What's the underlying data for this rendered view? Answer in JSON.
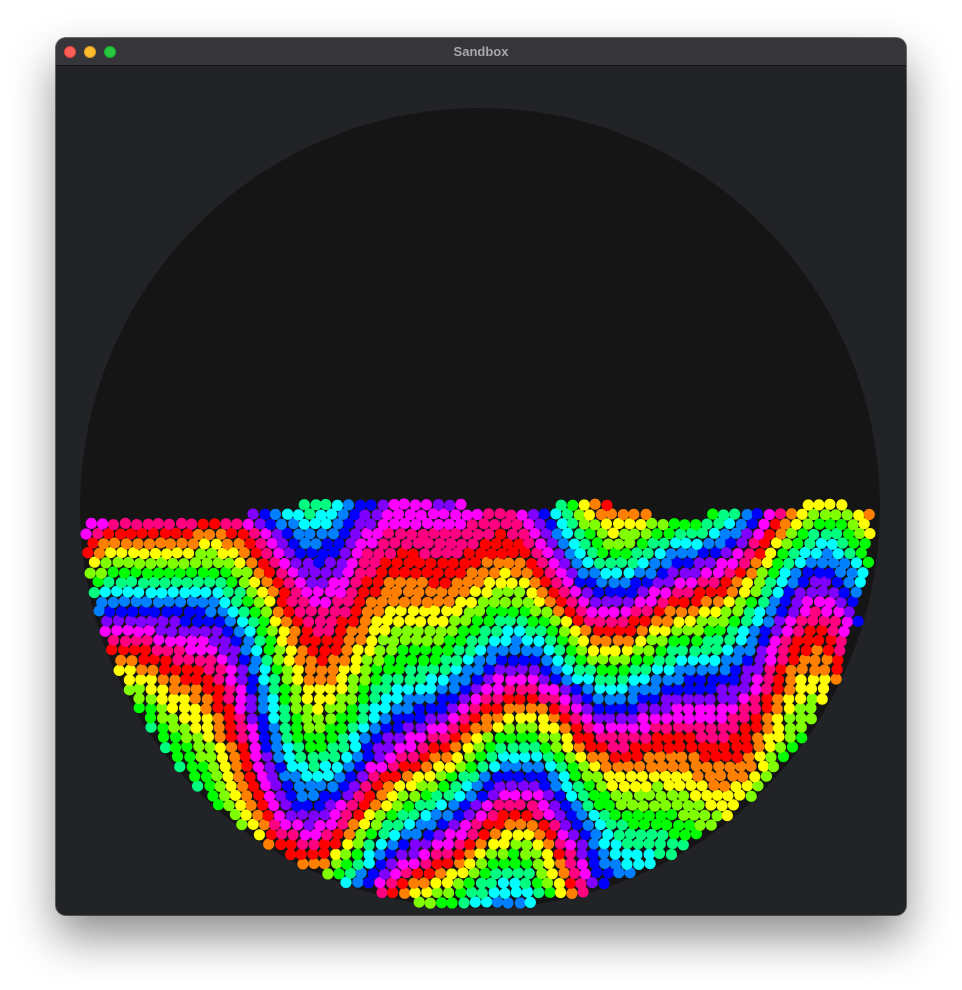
{
  "window": {
    "title": "Sandbox"
  },
  "scene": {
    "background_color": "#212327",
    "container_color": "#151516",
    "particle_palette": [
      "#ff0000",
      "#ff8000",
      "#ffff00",
      "#80ff00",
      "#00ff00",
      "#00ff80",
      "#00ffff",
      "#0080ff",
      "#0000ff",
      "#8000ff",
      "#ff00ff",
      "#ff0080"
    ]
  }
}
